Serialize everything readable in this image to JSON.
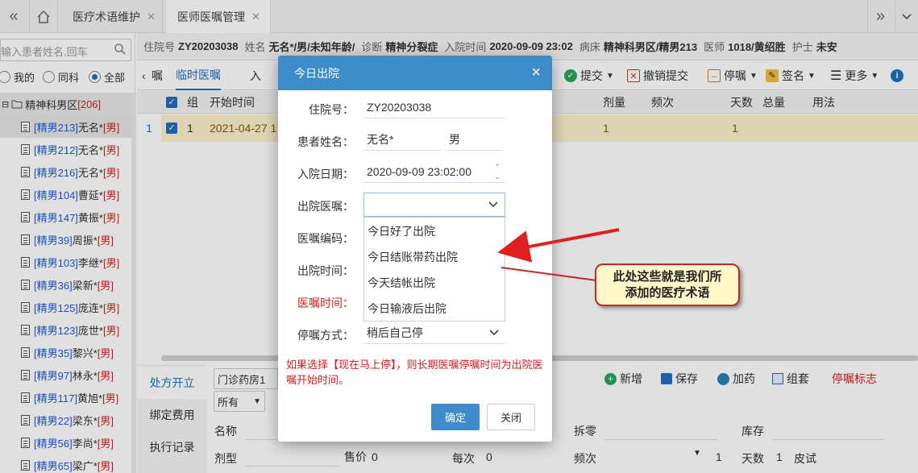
{
  "topbar": {
    "tabs": [
      {
        "label": "医疗术语维护",
        "active": false
      },
      {
        "label": "医师医嘱管理",
        "active": true
      }
    ]
  },
  "left_panel": {
    "search_placeholder": "输入患者姓名,回车",
    "filters": [
      {
        "label": "我的",
        "selected": false
      },
      {
        "label": "同科",
        "selected": false
      },
      {
        "label": "全部",
        "selected": true
      }
    ],
    "root": {
      "label": "精神科男区",
      "count": "[206]"
    },
    "patients": [
      {
        "bed": "[精男213]",
        "name": "无名*",
        "sex": "[男]"
      },
      {
        "bed": "[精男212]",
        "name": "无名*",
        "sex": "[男]"
      },
      {
        "bed": "[精男216]",
        "name": "无名*",
        "sex": "[男]"
      },
      {
        "bed": "[精男104]",
        "name": "曹延*",
        "sex": "[男]"
      },
      {
        "bed": "[精男147]",
        "name": "黄振*",
        "sex": "[男]"
      },
      {
        "bed": "[精男39]",
        "name": "周振*",
        "sex": "[男]"
      },
      {
        "bed": "[精男103]",
        "name": "李继*",
        "sex": "[男]"
      },
      {
        "bed": "[精男36]",
        "name": "梁新*",
        "sex": "[男]"
      },
      {
        "bed": "[精男125]",
        "name": "庞连*",
        "sex": "[男]"
      },
      {
        "bed": "[精男123]",
        "name": "庞世*",
        "sex": "[男]"
      },
      {
        "bed": "[精男35]",
        "name": "黎兴*",
        "sex": "[男]"
      },
      {
        "bed": "[精男97]",
        "name": "林永*",
        "sex": "[男]"
      },
      {
        "bed": "[精男117]",
        "name": "黄旭*",
        "sex": "[男]"
      },
      {
        "bed": "[精男22]",
        "name": "梁东*",
        "sex": "[男]"
      },
      {
        "bed": "[精男56]",
        "name": "李尚*",
        "sex": "[男]"
      },
      {
        "bed": "[精男65]",
        "name": "梁广*",
        "sex": "[男]"
      }
    ]
  },
  "info_bar": {
    "admission_no_label": "住院号",
    "admission_no": "ZY20203038",
    "name_label": "姓名",
    "name": "无名*/男/未知年龄/",
    "diagnosis_label": "诊断",
    "diagnosis": "精神分裂症",
    "admit_time_label": "入院时间",
    "admit_time": "2020-09-09 23:02",
    "ward_label": "病床",
    "ward": "精神科男区/精男213",
    "doctor_label": "医师",
    "doctor": "1018/黄绍胜",
    "nurse_label": "护士",
    "nurse": "未安"
  },
  "sub_toolbar": {
    "tab_prev": "嘱",
    "tab_temp": "临时医嘱",
    "tab_next": "入",
    "submit": "提交",
    "revoke": "撤销提交",
    "stop": "停嘱",
    "sign": "签名",
    "more": "更多"
  },
  "grid": {
    "headers": {
      "group": "组",
      "start_time": "开始时间",
      "dose": "剂量",
      "freq": "频次",
      "days": "天数",
      "total": "总量",
      "usage": "用法"
    },
    "row": {
      "index": "1",
      "group": "1",
      "start_time": "2021-04-27 1",
      "dose": "1",
      "days": "1"
    }
  },
  "bottom": {
    "nav": [
      "处方开立",
      "绑定费用",
      "执行记录"
    ],
    "pharmacy": "门诊药房1",
    "filter": "所有",
    "add": "新增",
    "save": "保存",
    "add_drug": "加药",
    "group_set": "组套",
    "stop_flag": "停嘱标志",
    "labels": {
      "name": "名称",
      "split": "拆零",
      "stock": "库存",
      "dosage_form": "剂型",
      "price": "售价",
      "each": "每次",
      "freq": "频次",
      "days": "天数",
      "skin_test": "皮试"
    },
    "values": {
      "price": "0",
      "each": "0",
      "freq_val": "1",
      "days": "1"
    }
  },
  "dialog": {
    "title": "今日出院",
    "close": "×",
    "fields": {
      "admission_no_label": "住院号：",
      "admission_no": "ZY20203038",
      "patient_name_label": "患者姓名：",
      "patient_name": "无名*",
      "patient_sex": "男",
      "admit_date_label": "入院日期：",
      "admit_date": "2020-09-09 23:02:00",
      "discharge_order_label": "出院医嘱：",
      "order_code_label": "医嘱编码：",
      "discharge_time_label": "出院时间：",
      "order_time_label": "医嘱时间：",
      "stop_mode_label": "停嘱方式：",
      "stop_mode": "稍后自己停"
    },
    "dropdown_options": [
      "今日好了出院",
      "今日结账带药出院",
      "今天结帐出院",
      "今日输液后出院"
    ],
    "note": "如果选择【现在马上停】，则长期医嘱停嘱时间为出院医嘱开始时间。",
    "ok": "确定",
    "cancel": "关闭"
  },
  "callout": {
    "text_line1": "此处这些就是我们所",
    "text_line2": "添加的医疗术语"
  },
  "colors": {
    "accent": "#3c8dc9",
    "warning": "#d21f1f",
    "selected_row": "#fbf2cf"
  }
}
